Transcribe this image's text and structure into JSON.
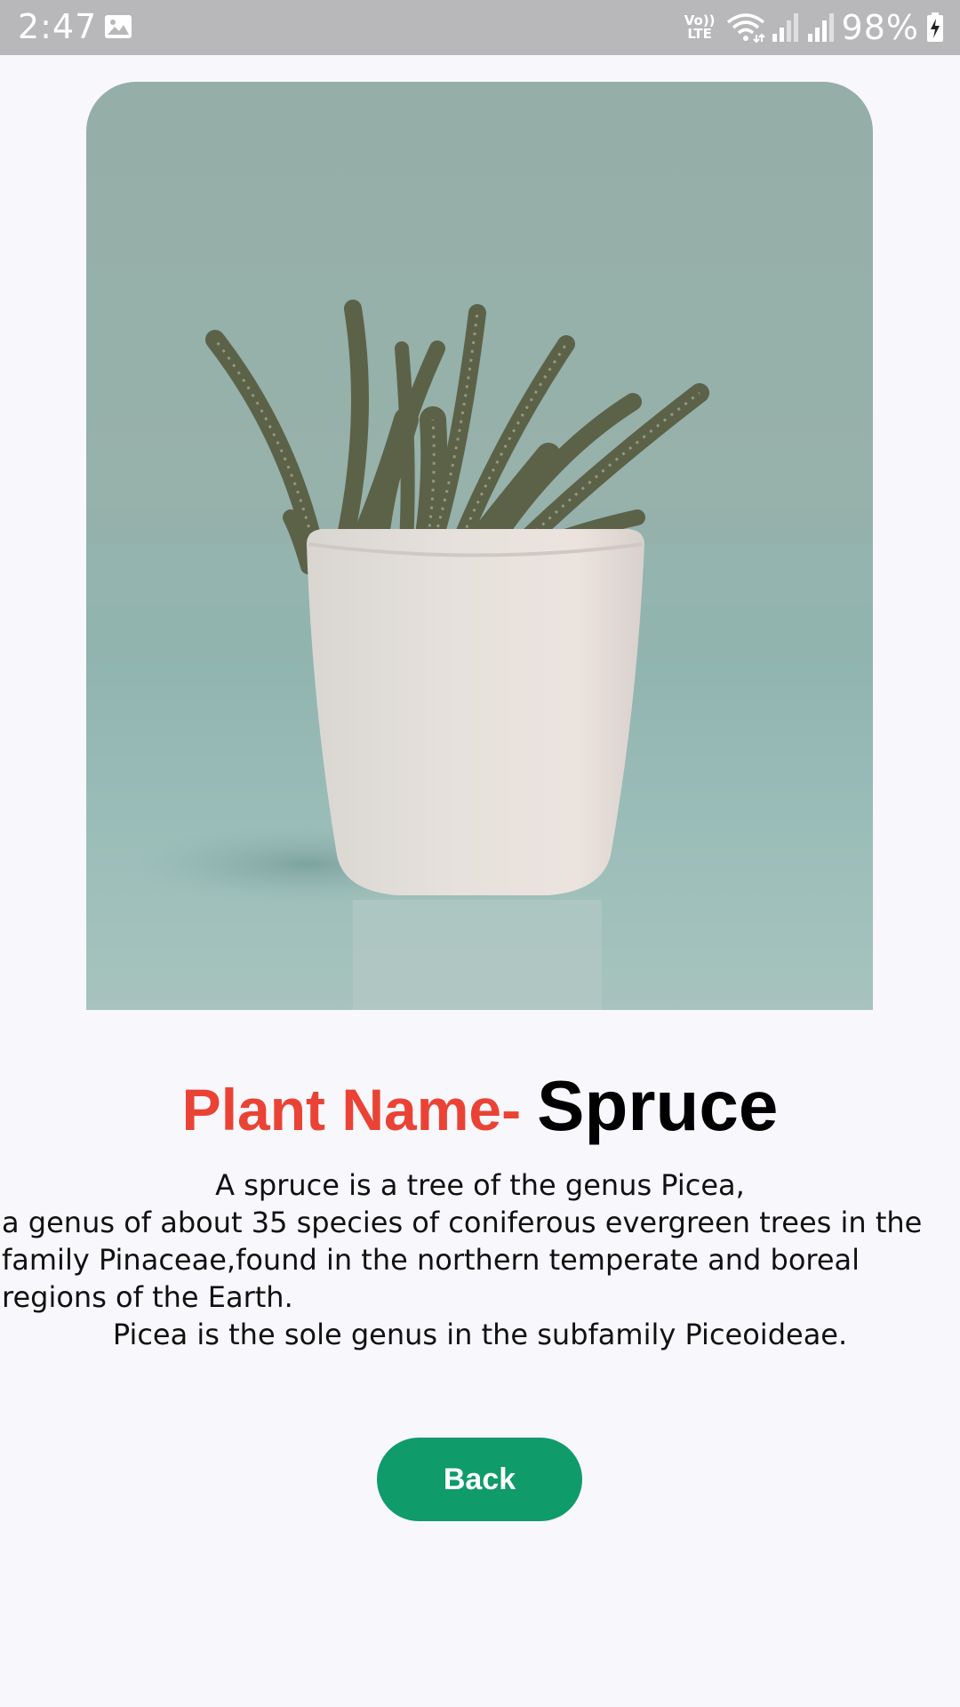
{
  "status_bar": {
    "time": "2:47",
    "volte_top": "Vo))",
    "volte_bottom": "LTE",
    "battery_percent": "98%",
    "icons": [
      "image-icon",
      "volte-icon",
      "wifi-icon",
      "signal-icon",
      "signal-icon",
      "battery-charging-icon"
    ]
  },
  "plant_image": {
    "icon": "potted-plant-photo"
  },
  "title": {
    "label": "Plant Name-",
    "value": "Spruce",
    "label_color": "#ea4335",
    "value_color": "#000000"
  },
  "description": {
    "lines": [
      "A spruce is a tree of the genus Picea,",
      " a genus of about 35 species of coniferous evergreen trees in the",
      "family Pinaceae,found in the northern temperate and boreal",
      "regions of the Earth.",
      "Picea is the sole genus in the subfamily Piceoideae."
    ]
  },
  "back_button": {
    "label": "Back",
    "color": "#0f9b6a"
  }
}
